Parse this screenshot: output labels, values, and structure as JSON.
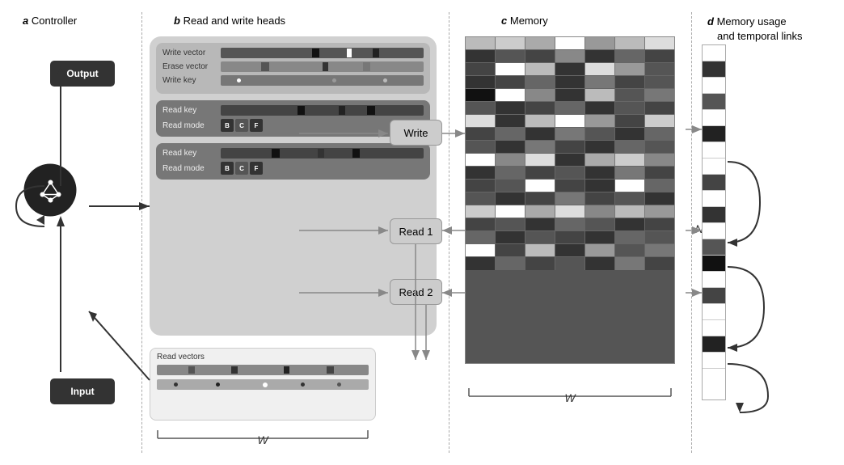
{
  "sections": {
    "a": {
      "letter": "a",
      "title": "Controller"
    },
    "b": {
      "letter": "b",
      "title": "Read and write heads"
    },
    "c": {
      "letter": "c",
      "title": "Memory"
    },
    "d": {
      "letter": "d",
      "title": "Memory usage",
      "subtitle": "and temporal links"
    }
  },
  "controller": {
    "output_label": "Output",
    "input_label": "Input"
  },
  "read_write": {
    "write_head": {
      "write_vector_label": "Write vector",
      "erase_vector_label": "Erase vector",
      "write_key_label": "Write key"
    },
    "read_head_1": {
      "read_key_label": "Read key",
      "read_mode_label": "Read mode",
      "mode_buttons": [
        "B",
        "C",
        "F"
      ]
    },
    "read_head_2": {
      "read_key_label": "Read key",
      "read_mode_label": "Read mode",
      "mode_buttons": [
        "B",
        "C",
        "F"
      ]
    }
  },
  "action_boxes": {
    "write_label": "Write",
    "read1_label": "Read 1",
    "read2_label": "Read 2"
  },
  "read_vectors_label": "Read vectors",
  "w_label": "W",
  "n_label": "N"
}
